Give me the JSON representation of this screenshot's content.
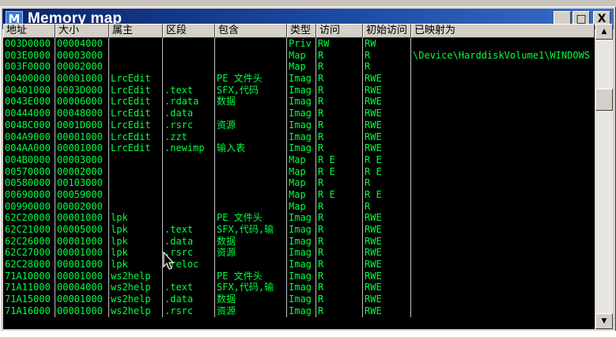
{
  "window": {
    "title": "Memory map",
    "icon_letter": "M"
  },
  "controls": {
    "minimize": "_",
    "restore": "□",
    "close": "X"
  },
  "columns": [
    "地址",
    "大小",
    "属主",
    "区段",
    "包含",
    "类型",
    "访问",
    "初始访问",
    "已映射为"
  ],
  "rows": [
    [
      "003D0000",
      "00004000",
      "",
      "",
      "",
      "Priv",
      "RW",
      "RW",
      ""
    ],
    [
      "003E0000",
      "00003000",
      "",
      "",
      "",
      "Map",
      "R",
      "R",
      "\\Device\\HarddiskVolume1\\WINDOWS"
    ],
    [
      "003F0000",
      "00002000",
      "",
      "",
      "",
      "Map",
      "R",
      "R",
      ""
    ],
    [
      "00400000",
      "00001000",
      "LrcEdit",
      "",
      "PE 文件头",
      "Imag",
      "R",
      "RWE",
      ""
    ],
    [
      "00401000",
      "0003D000",
      "LrcEdit",
      ".text",
      "SFX,代码",
      "Imag",
      "R",
      "RWE",
      ""
    ],
    [
      "0043E000",
      "00006000",
      "LrcEdit",
      ".rdata",
      "数据",
      "Imag",
      "R",
      "RWE",
      ""
    ],
    [
      "00444000",
      "00048000",
      "LrcEdit",
      ".data",
      "",
      "Imag",
      "R",
      "RWE",
      ""
    ],
    [
      "0048C000",
      "0001D000",
      "LrcEdit",
      ".rsrc",
      "资源",
      "Imag",
      "R",
      "RWE",
      ""
    ],
    [
      "004A9000",
      "00001000",
      "LrcEdit",
      ".zzt",
      "",
      "Imag",
      "R",
      "RWE",
      ""
    ],
    [
      "004AA000",
      "00001000",
      "LrcEdit",
      ".newimp",
      "输入表",
      "Imag",
      "R",
      "RWE",
      ""
    ],
    [
      "004B0000",
      "00003000",
      "",
      "",
      "",
      "Map",
      "R E",
      "R E",
      ""
    ],
    [
      "00570000",
      "00002000",
      "",
      "",
      "",
      "Map",
      "R E",
      "R E",
      ""
    ],
    [
      "00580000",
      "00103000",
      "",
      "",
      "",
      "Map",
      "R",
      "R",
      ""
    ],
    [
      "00690000",
      "00059000",
      "",
      "",
      "",
      "Map",
      "R E",
      "R E",
      ""
    ],
    [
      "00990000",
      "00002000",
      "",
      "",
      "",
      "Map",
      "R",
      "R",
      ""
    ],
    [
      "62C20000",
      "00001000",
      "lpk",
      "",
      "PE 文件头",
      "Imag",
      "R",
      "RWE",
      ""
    ],
    [
      "62C21000",
      "00005000",
      "lpk",
      ".text",
      "SFX,代码,输",
      "Imag",
      "R",
      "RWE",
      ""
    ],
    [
      "62C26000",
      "00001000",
      "lpk",
      ".data",
      "数据",
      "Imag",
      "R",
      "RWE",
      ""
    ],
    [
      "62C27000",
      "00001000",
      "lpk",
      ".rsrc",
      "资源",
      "Imag",
      "R",
      "RWE",
      ""
    ],
    [
      "62C28000",
      "00001000",
      "lpk",
      ".reloc",
      "",
      "Imag",
      "R",
      "RWE",
      ""
    ],
    [
      "71A10000",
      "00001000",
      "ws2help",
      "",
      "PE 文件头",
      "Imag",
      "R",
      "RWE",
      ""
    ],
    [
      "71A11000",
      "00004000",
      "ws2help",
      ".text",
      "SFX,代码,输",
      "Imag",
      "R",
      "RWE",
      ""
    ],
    [
      "71A15000",
      "00001000",
      "ws2help",
      ".data",
      "数据",
      "Imag",
      "R",
      "RWE",
      ""
    ],
    [
      "71A16000",
      "00001000",
      "ws2help",
      ".rsrc",
      "资源",
      "Imag",
      "R",
      "RWE",
      ""
    ]
  ],
  "colors": {
    "text": "#00ff40",
    "background": "#000000",
    "titlebar": "#0a246a"
  },
  "icons": {
    "app": "memory-map-app-icon",
    "scroll_up": "up-arrow-icon",
    "scroll_down": "down-arrow-icon",
    "pointer": "mouse-pointer-icon"
  }
}
